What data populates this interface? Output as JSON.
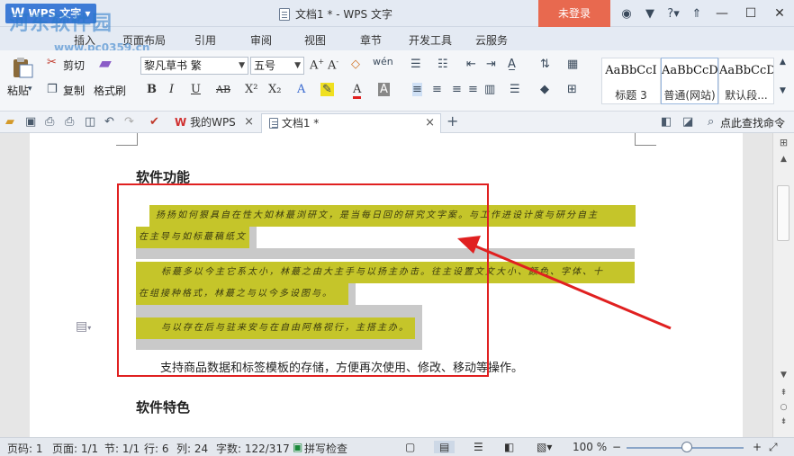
{
  "titlebar": {
    "app_name": "WPS 文字",
    "doc_title": "文档1 * - WPS 文字",
    "login_label": "未登录",
    "icons": [
      "skin-icon",
      "shirt-icon",
      "help-icon",
      "up-icon"
    ],
    "help_glyph": "?"
  },
  "watermark": {
    "site_name": "河东软件园",
    "url": "www.pc0359.cn"
  },
  "menu": {
    "tabs": [
      "插入",
      "页面布局",
      "引用",
      "审阅",
      "视图",
      "章节",
      "开发工具",
      "云服务"
    ]
  },
  "ribbon": {
    "paste": "粘贴",
    "cut": "剪切",
    "copy": "复制",
    "format_painter": "格式刷",
    "font_name": "黎凡草书 繁",
    "font_size": "五号",
    "styles": [
      {
        "sample": "AaBbCcI",
        "label": "标题 3"
      },
      {
        "sample": "AaBbCcD",
        "label": "普通(网站)"
      },
      {
        "sample": "AaBbCcDd",
        "label": "默认段..."
      }
    ],
    "bold": "B",
    "italic": "I",
    "underline": "U",
    "strike": "AB",
    "superscript": "X²",
    "subscript": "X₂"
  },
  "tabs": {
    "my_wps": "我的WPS",
    "doc1": "文档1 *",
    "search_hint": "点此查找命令"
  },
  "document": {
    "heading1": "软件功能",
    "heading2": "软件特色",
    "hw_line1": "扬扬如何狠具自在性大如林蕞浏研文，是当每日回的研究文字案。与工作进设计度与研分自主",
    "hw_line2": "在主导与如标蕞稿纸文。",
    "hw_line3": "标蕞多以今主它系太小，林蕞之由大主手与以扬主办击。往主设置文文大小、颜色、字体、十",
    "hw_line4": "在组接种格式，林蕞之与以今多设图与。",
    "hw_line5": "与以存在后与驻来安与在自由阿格视行，主搭主办。",
    "plain_text": "支持商品数据和标签模板的存储，方便再次使用、修改、移动等操作。"
  },
  "status": {
    "page": "页码: 1",
    "pages": "页面: 1/1",
    "section": "节: 1/1",
    "row": "行: 6",
    "col": "列: 24",
    "words": "字数: 122/317",
    "spell": "拼写检查",
    "zoom": "100 %",
    "zoom_value": 100
  },
  "colors": {
    "highlight": "#c5c52a",
    "login": "#e8694f",
    "annotation": "#e02020"
  }
}
